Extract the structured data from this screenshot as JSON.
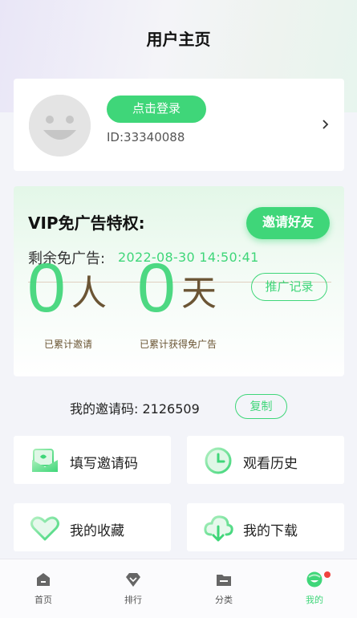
{
  "header": {
    "title": "用户主页"
  },
  "user": {
    "login_label": "点击登录",
    "id_text": "ID:33340088"
  },
  "vip": {
    "title": "VIP免广告特权:",
    "invite_label": "邀请好友",
    "remaining_label": "剩余免广告:",
    "remaining_time": "2022-08-30 14:50:41",
    "invited_count": "0",
    "invited_unit": "人",
    "days_count": "0",
    "days_unit": "天",
    "record_label": "推广记录",
    "invited_caption": "已累计邀请",
    "days_caption": "已累计获得免广告"
  },
  "invite_code": {
    "label": "我的邀请码:",
    "code": "2126509",
    "copy_label": "复制"
  },
  "tiles": [
    {
      "label": "填写邀请码",
      "icon": "envelope-heart-icon"
    },
    {
      "label": "观看历史",
      "icon": "clock-icon"
    },
    {
      "label": "我的收藏",
      "icon": "heart-icon"
    },
    {
      "label": "我的下载",
      "icon": "cloud-download-icon"
    }
  ],
  "nav": [
    {
      "label": "首页",
      "icon": "home-icon"
    },
    {
      "label": "排行",
      "icon": "ranking-icon"
    },
    {
      "label": "分类",
      "icon": "folder-icon"
    },
    {
      "label": "我的",
      "icon": "profile-icon",
      "active": true
    }
  ],
  "colors": {
    "accent": "#3fd679",
    "brown": "#6b5534",
    "badge": "#f0423f"
  }
}
